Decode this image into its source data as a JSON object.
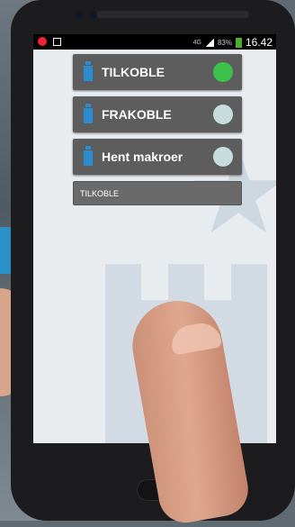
{
  "statusbar": {
    "network": "4G",
    "battery": "83%",
    "time": "16.42",
    "battery_color": "#4caf2a"
  },
  "buttons": [
    {
      "label": "TILKOBLE",
      "led_color": "#3cc24a",
      "icon": "battery-icon"
    },
    {
      "label": "FRAKOBLE",
      "led_color": "#c7dcdc",
      "icon": "battery-icon"
    },
    {
      "label": "Hent makroer",
      "led_color": "#c7dcdc",
      "icon": "battery-icon"
    }
  ],
  "status_field": {
    "value": "TILKOBLE"
  },
  "colors": {
    "accent": "#2b8dd0",
    "button_bg": "#5d5d5d",
    "screen_bg": "#e9ecee"
  }
}
